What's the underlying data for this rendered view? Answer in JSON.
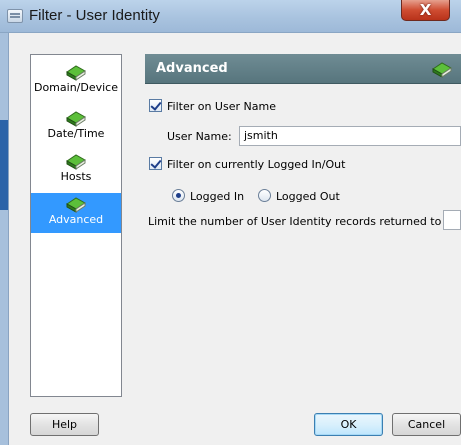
{
  "window": {
    "title": "Filter - User Identity",
    "close_label": "X"
  },
  "nav": {
    "items": [
      {
        "label": "Domain/Device",
        "icon": "green-book-icon",
        "selected": false
      },
      {
        "label": "Date/Time",
        "icon": "green-book-icon",
        "selected": false
      },
      {
        "label": "Hosts",
        "icon": "green-book-icon",
        "selected": false
      },
      {
        "label": "Advanced",
        "icon": "green-book-icon",
        "selected": true
      }
    ]
  },
  "panel": {
    "title": "Advanced",
    "filter_user_name": {
      "label": "Filter on User Name",
      "checked": true
    },
    "user_name": {
      "label": "User Name:",
      "value": "jsmith"
    },
    "filter_logged": {
      "label": "Filter on currently Logged In/Out",
      "checked": true
    },
    "logged_in": {
      "label": "Logged In",
      "selected": true
    },
    "logged_out": {
      "label": "Logged Out",
      "selected": false
    },
    "limit": {
      "label": "Limit the number of User Identity records returned to",
      "value": ""
    }
  },
  "buttons": {
    "help": "Help",
    "ok": "OK",
    "cancel": "Cancel"
  },
  "colors": {
    "selected_nav": "#3399ff",
    "panel_header": "#5f7d85",
    "close_button": "#c8462e"
  }
}
